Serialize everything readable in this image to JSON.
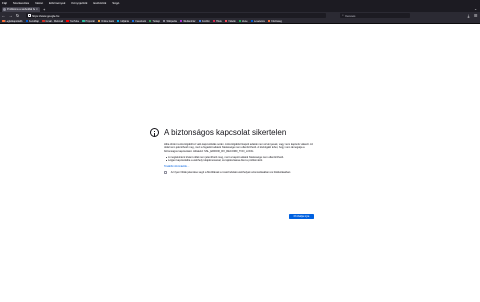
{
  "menu": [
    "Fájl",
    "Szerkesztés",
    "Nézet",
    "Előzmények",
    "Könyvjelzők",
    "Eszközök",
    "Súgó"
  ],
  "tab": {
    "title": "Probléma a weboldal betöltésekor",
    "close": "×"
  },
  "new_tab": "+",
  "tabs_list": "⌄",
  "nav": {
    "back": "←",
    "forward": "→",
    "reload": "↻",
    "home": "⌂"
  },
  "url": "https://www.google.hu",
  "search": {
    "icon": "search-icon",
    "placeholder": "Keresés"
  },
  "toolbar_right": [
    "⤓",
    "☰"
  ],
  "bookmarks": [
    {
      "label": "Legfelkapottabb",
      "color": "#ff7139"
    },
    {
      "label": "Kezdőlap",
      "color": "#0060df"
    },
    {
      "label": "Gmail - Webmail",
      "color": "#d93025"
    },
    {
      "label": "YouTube",
      "color": "#ff0000"
    },
    {
      "label": "Hírportál",
      "color": "#2ac3a2"
    },
    {
      "label": "Online bank",
      "color": "#ffa436"
    },
    {
      "label": "Időjárás",
      "color": "#00b3f4"
    },
    {
      "label": "Facebook",
      "color": "#1877f2"
    },
    {
      "label": "Térkép",
      "color": "#34a853"
    },
    {
      "label": "Wikipédia",
      "color": "#8f8f9d"
    },
    {
      "label": "Webáruház",
      "color": "#b833e1"
    },
    {
      "label": "Fordító",
      "color": "#4285f4"
    },
    {
      "label": "Hírek",
      "color": "#e22850"
    },
    {
      "label": "Videók",
      "color": "#ff4f5e"
    },
    {
      "label": "Zene",
      "color": "#1db954"
    },
    {
      "label": "Levelezés",
      "color": "#0060df"
    },
    {
      "label": "Közösség",
      "color": "#ff7139"
    }
  ],
  "error": {
    "icon": "info-icon",
    "title": "A biztonságos kapcsolat sikertelen",
    "paragraph": "Hiba történt a kiszolgálóhoz való kapcsolódás során. A kiszolgálótól kapott adatok nem érvényesek, vagy nem kaptunk választ. Az oldal nem jeleníthető meg, mert a fogadott adatok hitelessége nem ellenőrizhető. A kiszolgáló lehet, hogy nem támogatja a biztonságos kapcsolatot. Hibakód: SSL_ERROR_RX_RECORD_TOO_LONG",
    "bullets": [
      "A megtekinteni kívánt oldal nem jeleníthető meg, mert a kapott adatok hitelessége nem ellenőrizhető.",
      "Lépjen kapcsolatba a webhely tulajdonosaival, és tájékoztassa őket a problémáról."
    ],
    "learn_more": "További információk…",
    "checkbox": "Az ilyen hibák jelentése segít a Mozillának a rosszindulatú webhelyek azonosításában és blokkolásában",
    "retry": "Próbálja újra"
  }
}
